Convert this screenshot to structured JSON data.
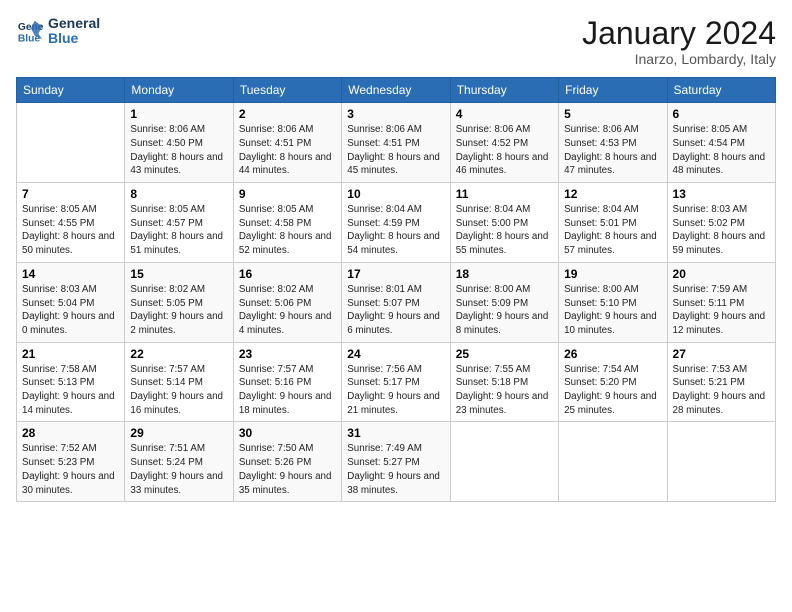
{
  "header": {
    "logo_line1": "General",
    "logo_line2": "Blue",
    "month": "January 2024",
    "location": "Inarzo, Lombardy, Italy"
  },
  "days_of_week": [
    "Sunday",
    "Monday",
    "Tuesday",
    "Wednesday",
    "Thursday",
    "Friday",
    "Saturday"
  ],
  "weeks": [
    [
      {
        "day": "",
        "empty": true
      },
      {
        "day": "1",
        "sunrise": "8:06 AM",
        "sunset": "4:50 PM",
        "daylight": "8 hours and 43 minutes."
      },
      {
        "day": "2",
        "sunrise": "8:06 AM",
        "sunset": "4:51 PM",
        "daylight": "8 hours and 44 minutes."
      },
      {
        "day": "3",
        "sunrise": "8:06 AM",
        "sunset": "4:51 PM",
        "daylight": "8 hours and 45 minutes."
      },
      {
        "day": "4",
        "sunrise": "8:06 AM",
        "sunset": "4:52 PM",
        "daylight": "8 hours and 46 minutes."
      },
      {
        "day": "5",
        "sunrise": "8:06 AM",
        "sunset": "4:53 PM",
        "daylight": "8 hours and 47 minutes."
      },
      {
        "day": "6",
        "sunrise": "8:05 AM",
        "sunset": "4:54 PM",
        "daylight": "8 hours and 48 minutes."
      }
    ],
    [
      {
        "day": "7",
        "sunrise": "8:05 AM",
        "sunset": "4:55 PM",
        "daylight": "8 hours and 50 minutes."
      },
      {
        "day": "8",
        "sunrise": "8:05 AM",
        "sunset": "4:57 PM",
        "daylight": "8 hours and 51 minutes."
      },
      {
        "day": "9",
        "sunrise": "8:05 AM",
        "sunset": "4:58 PM",
        "daylight": "8 hours and 52 minutes."
      },
      {
        "day": "10",
        "sunrise": "8:04 AM",
        "sunset": "4:59 PM",
        "daylight": "8 hours and 54 minutes."
      },
      {
        "day": "11",
        "sunrise": "8:04 AM",
        "sunset": "5:00 PM",
        "daylight": "8 hours and 55 minutes."
      },
      {
        "day": "12",
        "sunrise": "8:04 AM",
        "sunset": "5:01 PM",
        "daylight": "8 hours and 57 minutes."
      },
      {
        "day": "13",
        "sunrise": "8:03 AM",
        "sunset": "5:02 PM",
        "daylight": "8 hours and 59 minutes."
      }
    ],
    [
      {
        "day": "14",
        "sunrise": "8:03 AM",
        "sunset": "5:04 PM",
        "daylight": "9 hours and 0 minutes."
      },
      {
        "day": "15",
        "sunrise": "8:02 AM",
        "sunset": "5:05 PM",
        "daylight": "9 hours and 2 minutes."
      },
      {
        "day": "16",
        "sunrise": "8:02 AM",
        "sunset": "5:06 PM",
        "daylight": "9 hours and 4 minutes."
      },
      {
        "day": "17",
        "sunrise": "8:01 AM",
        "sunset": "5:07 PM",
        "daylight": "9 hours and 6 minutes."
      },
      {
        "day": "18",
        "sunrise": "8:00 AM",
        "sunset": "5:09 PM",
        "daylight": "9 hours and 8 minutes."
      },
      {
        "day": "19",
        "sunrise": "8:00 AM",
        "sunset": "5:10 PM",
        "daylight": "9 hours and 10 minutes."
      },
      {
        "day": "20",
        "sunrise": "7:59 AM",
        "sunset": "5:11 PM",
        "daylight": "9 hours and 12 minutes."
      }
    ],
    [
      {
        "day": "21",
        "sunrise": "7:58 AM",
        "sunset": "5:13 PM",
        "daylight": "9 hours and 14 minutes."
      },
      {
        "day": "22",
        "sunrise": "7:57 AM",
        "sunset": "5:14 PM",
        "daylight": "9 hours and 16 minutes."
      },
      {
        "day": "23",
        "sunrise": "7:57 AM",
        "sunset": "5:16 PM",
        "daylight": "9 hours and 18 minutes."
      },
      {
        "day": "24",
        "sunrise": "7:56 AM",
        "sunset": "5:17 PM",
        "daylight": "9 hours and 21 minutes."
      },
      {
        "day": "25",
        "sunrise": "7:55 AM",
        "sunset": "5:18 PM",
        "daylight": "9 hours and 23 minutes."
      },
      {
        "day": "26",
        "sunrise": "7:54 AM",
        "sunset": "5:20 PM",
        "daylight": "9 hours and 25 minutes."
      },
      {
        "day": "27",
        "sunrise": "7:53 AM",
        "sunset": "5:21 PM",
        "daylight": "9 hours and 28 minutes."
      }
    ],
    [
      {
        "day": "28",
        "sunrise": "7:52 AM",
        "sunset": "5:23 PM",
        "daylight": "9 hours and 30 minutes."
      },
      {
        "day": "29",
        "sunrise": "7:51 AM",
        "sunset": "5:24 PM",
        "daylight": "9 hours and 33 minutes."
      },
      {
        "day": "30",
        "sunrise": "7:50 AM",
        "sunset": "5:26 PM",
        "daylight": "9 hours and 35 minutes."
      },
      {
        "day": "31",
        "sunrise": "7:49 AM",
        "sunset": "5:27 PM",
        "daylight": "9 hours and 38 minutes."
      },
      {
        "day": "",
        "empty": true
      },
      {
        "day": "",
        "empty": true
      },
      {
        "day": "",
        "empty": true
      }
    ]
  ]
}
